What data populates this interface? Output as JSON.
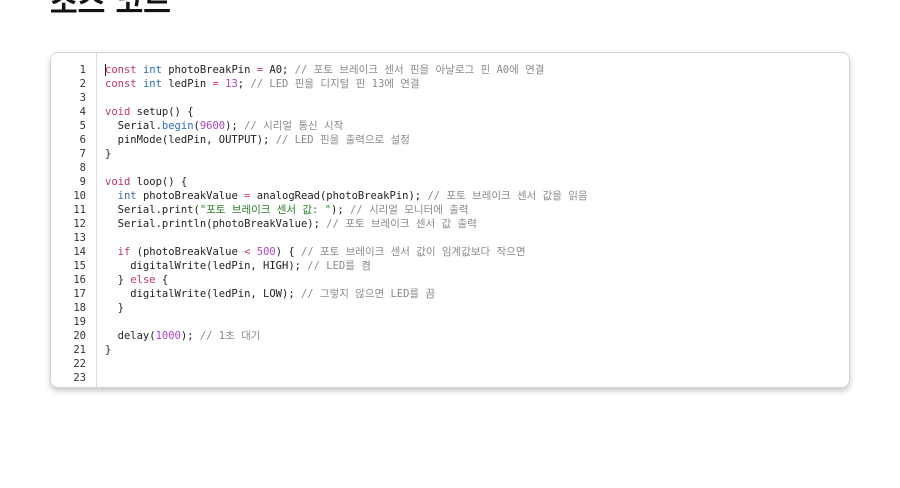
{
  "page": {
    "title": "소스 코드"
  },
  "colors": {
    "keyword": "#c8336b",
    "type": "#2b6cc4",
    "number": "#b044c8",
    "string": "#2a7f2a",
    "comment": "#8a8a8a",
    "plain": "#222222"
  },
  "editor": {
    "line_numbers": [
      "1",
      "2",
      "3",
      "4",
      "5",
      "6",
      "7",
      "8",
      "9",
      "10",
      "11",
      "12",
      "13",
      "14",
      "15",
      "16",
      "17",
      "18",
      "19",
      "20",
      "21",
      "22",
      "23"
    ],
    "lines": [
      [
        [
          "keyword",
          "const"
        ],
        [
          "plain",
          " "
        ],
        [
          "type",
          "int"
        ],
        [
          "plain",
          " photoBreakPin "
        ],
        [
          "keyword",
          "="
        ],
        [
          "plain",
          " A0; "
        ],
        [
          "comment",
          "// 포토 브레이크 센서 핀을 아날로그 핀 A0에 연결"
        ]
      ],
      [
        [
          "keyword",
          "const"
        ],
        [
          "plain",
          " "
        ],
        [
          "type",
          "int"
        ],
        [
          "plain",
          " ledPin "
        ],
        [
          "keyword",
          "="
        ],
        [
          "plain",
          " "
        ],
        [
          "number",
          "13"
        ],
        [
          "plain",
          "; "
        ],
        [
          "comment",
          "// LED 핀을 디지털 핀 13에 연결"
        ]
      ],
      [],
      [
        [
          "keyword",
          "void"
        ],
        [
          "plain",
          " setup() {"
        ]
      ],
      [
        [
          "plain",
          "  Serial."
        ],
        [
          "function",
          "begin"
        ],
        [
          "plain",
          "("
        ],
        [
          "number",
          "9600"
        ],
        [
          "plain",
          "); "
        ],
        [
          "comment",
          "// 시리얼 통신 시작"
        ]
      ],
      [
        [
          "plain",
          "  pinMode(ledPin, OUTPUT); "
        ],
        [
          "comment",
          "// LED 핀을 출력으로 설정"
        ]
      ],
      [
        [
          "plain",
          "}"
        ]
      ],
      [],
      [
        [
          "keyword",
          "void"
        ],
        [
          "plain",
          " loop() {"
        ]
      ],
      [
        [
          "plain",
          "  "
        ],
        [
          "type",
          "int"
        ],
        [
          "plain",
          " photoBreakValue "
        ],
        [
          "keyword",
          "="
        ],
        [
          "plain",
          " analogRead(photoBreakPin); "
        ],
        [
          "comment",
          "// 포토 브레이크 센서 값을 읽음"
        ]
      ],
      [
        [
          "plain",
          "  Serial.print("
        ],
        [
          "string",
          "\"포토 브레이크 센서 값: \""
        ],
        [
          "plain",
          "); "
        ],
        [
          "comment",
          "// 시리얼 모니터에 출력"
        ]
      ],
      [
        [
          "plain",
          "  Serial.println(photoBreakValue); "
        ],
        [
          "comment",
          "// 포토 브레이크 센서 값 출력"
        ]
      ],
      [],
      [
        [
          "plain",
          "  "
        ],
        [
          "keyword",
          "if"
        ],
        [
          "plain",
          " (photoBreakValue "
        ],
        [
          "keyword",
          "<"
        ],
        [
          "plain",
          " "
        ],
        [
          "number",
          "500"
        ],
        [
          "plain",
          ") { "
        ],
        [
          "comment",
          "// 포토 브레이크 센서 값이 임계값보다 작으면"
        ]
      ],
      [
        [
          "plain",
          "    digitalWrite(ledPin, HIGH); "
        ],
        [
          "comment",
          "// LED를 켬"
        ]
      ],
      [
        [
          "plain",
          "  } "
        ],
        [
          "keyword",
          "else"
        ],
        [
          "plain",
          " {"
        ]
      ],
      [
        [
          "plain",
          "    digitalWrite(ledPin, LOW); "
        ],
        [
          "comment",
          "// 그렇지 않으면 LED를 끔"
        ]
      ],
      [
        [
          "plain",
          "  }"
        ]
      ],
      [],
      [
        [
          "plain",
          "  delay("
        ],
        [
          "number",
          "1000"
        ],
        [
          "plain",
          "); "
        ],
        [
          "comment",
          "// 1초 대기"
        ]
      ],
      [
        [
          "plain",
          "}"
        ]
      ],
      [],
      []
    ]
  }
}
